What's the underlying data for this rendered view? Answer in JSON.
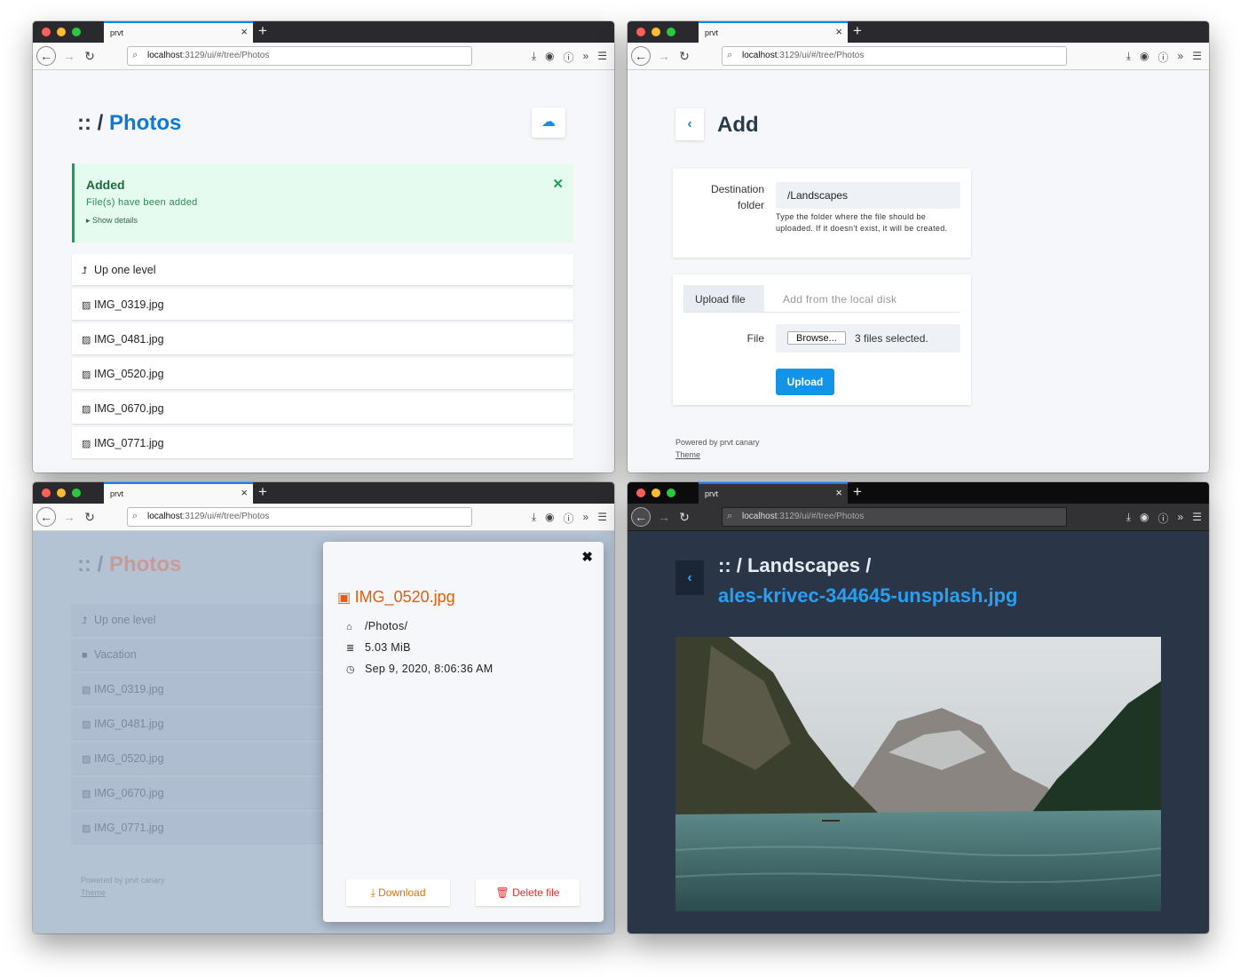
{
  "browser": {
    "tab_title": "prvt",
    "url_host": "localhost",
    "url_rest": ":3129/ui/#/tree/Photos"
  },
  "panel1": {
    "breadcrumb_sep": ":: /",
    "folder": "Photos",
    "alert": {
      "title": "Added",
      "message": "File(s) have been added",
      "details": "Show details"
    },
    "rows": [
      {
        "icon": "up-arrow-icon",
        "label": "Up one level"
      },
      {
        "icon": "image-file-icon",
        "label": "IMG_0319.jpg"
      },
      {
        "icon": "image-file-icon",
        "label": "IMG_0481.jpg"
      },
      {
        "icon": "image-file-icon",
        "label": "IMG_0520.jpg"
      },
      {
        "icon": "image-file-icon",
        "label": "IMG_0670.jpg"
      },
      {
        "icon": "image-file-icon",
        "label": "IMG_0771.jpg"
      }
    ]
  },
  "panel2": {
    "title": "Add",
    "dest_label_1": "Destination",
    "dest_label_2": "folder",
    "dest_value": "/Landscapes",
    "dest_help": "Type the folder where the file should be uploaded. If it doesn't exist, it will be created.",
    "tab_upload": "Upload file",
    "tab_local": "Add from the local disk",
    "file_label": "File",
    "browse": "Browse...",
    "files_selected": "3 files selected.",
    "upload_button": "Upload",
    "powered": "Powered by prvt canary",
    "theme": "Theme"
  },
  "panel3": {
    "breadcrumb_sep": ":: /",
    "folder": "Photos",
    "rows": [
      {
        "icon": "up-arrow-icon",
        "label": "Up one level"
      },
      {
        "icon": "folder-icon",
        "label": "Vacation"
      },
      {
        "icon": "image-file-icon",
        "label": "IMG_0319.jpg"
      },
      {
        "icon": "image-file-icon",
        "label": "IMG_0481.jpg"
      },
      {
        "icon": "image-file-icon",
        "label": "IMG_0520.jpg"
      },
      {
        "icon": "image-file-icon",
        "label": "IMG_0670.jpg"
      },
      {
        "icon": "image-file-icon",
        "label": "IMG_0771.jpg"
      }
    ],
    "powered": "Powered by prvt canary",
    "theme": "Theme",
    "modal": {
      "filename": "IMG_0520.jpg",
      "path": "/Photos/",
      "size": "5.03 MiB",
      "date": "Sep 9, 2020, 8:06:36 AM",
      "download": "Download",
      "delete": "Delete file"
    },
    "colors": {
      "accent": "#e05e0e",
      "danger": "#e03030"
    }
  },
  "panel4": {
    "breadcrumb": ":: / Landscapes /",
    "filename": "ales-krivec-344645-unsplash.jpg"
  }
}
